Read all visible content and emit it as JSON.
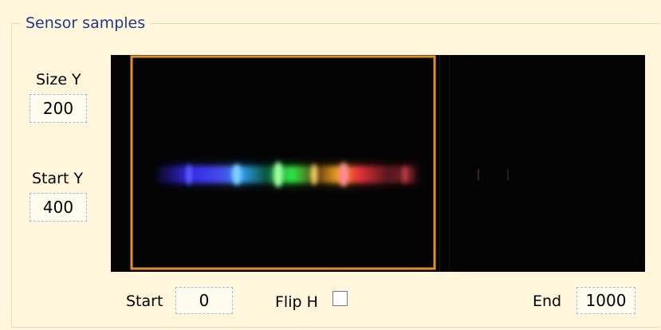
{
  "panel": {
    "title": "Sensor samples"
  },
  "size_y": {
    "label": "Size Y",
    "value": "200"
  },
  "start_y": {
    "label": "Start Y",
    "value": "400"
  },
  "start": {
    "label": "Start",
    "value": "0"
  },
  "flip_h": {
    "label": "Flip H",
    "checked": false
  },
  "end": {
    "label": "End",
    "value": "1000"
  },
  "sensor_view": {
    "background": "#040404",
    "selection_color": "#e0902a",
    "spectrum_colors": [
      "#3b2cff",
      "#4a55ff",
      "#2fa8ff",
      "#31ff4a",
      "#ffb020",
      "#ff3840",
      "#b03038"
    ]
  }
}
